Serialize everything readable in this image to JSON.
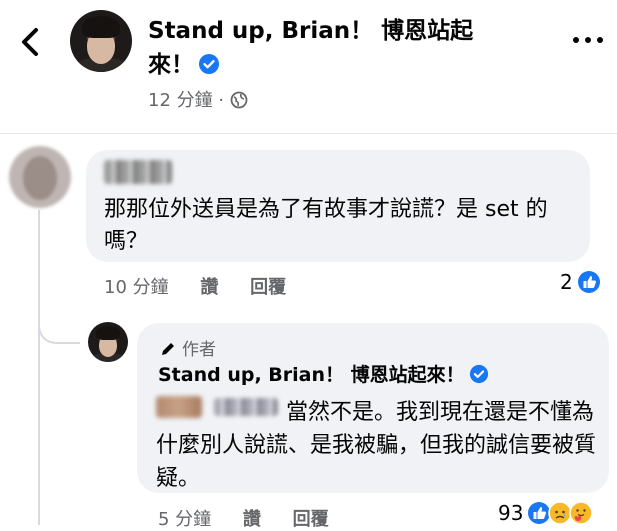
{
  "header": {
    "title": "Stand up, Brian！ 博恩站起來！",
    "timestamp": "12 分鐘",
    "separator": "·",
    "icons": [
      "back-arrow-icon",
      "verified-badge-icon",
      "globe-icon",
      "more-options-icon"
    ]
  },
  "comment": {
    "text": "那那位外送員是為了有故事才說謊？是 set 的嗎？",
    "time": "10 分鐘",
    "like_label": "讚",
    "reply_label": "回覆",
    "reaction_count": "2"
  },
  "reply": {
    "author_tag": "作者",
    "author_name": "Stand up, Brian！ 博恩站起來！",
    "text": "當然不是。我到現在還是不懂為什麼別人說謊、是我被騙，但我的誠信要被質疑。",
    "time": "5 分鐘",
    "like_label": "讚",
    "reply_label": "回覆",
    "reaction_count": "93"
  },
  "colors": {
    "accent": "#1877f2",
    "bubble": "#f0f2f5",
    "secondary_text": "#65676b"
  }
}
